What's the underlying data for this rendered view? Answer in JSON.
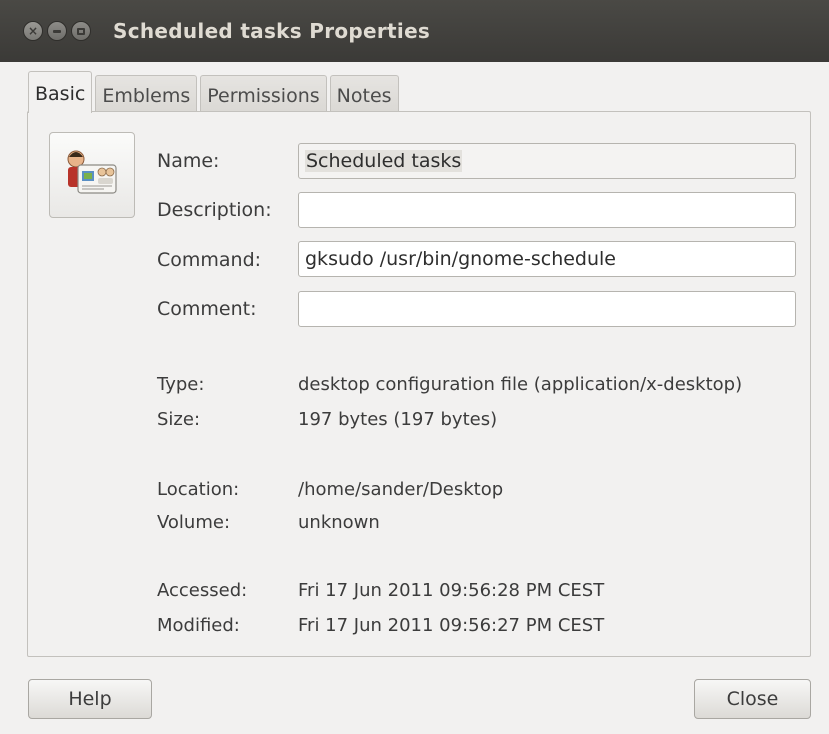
{
  "window": {
    "title": "Scheduled tasks Properties",
    "controls": [
      "close",
      "minimize",
      "maximize"
    ]
  },
  "tabs": [
    {
      "label": "Basic",
      "active": true
    },
    {
      "label": "Emblems",
      "active": false
    },
    {
      "label": "Permissions",
      "active": false
    },
    {
      "label": "Notes",
      "active": false
    }
  ],
  "icon": {
    "name": "schedule-app-icon"
  },
  "fields": {
    "name": {
      "label": "Name:",
      "value": "Scheduled tasks"
    },
    "description": {
      "label": "Description:",
      "value": ""
    },
    "command": {
      "label": "Command:",
      "value": "gksudo /usr/bin/gnome-schedule"
    },
    "comment": {
      "label": "Comment:",
      "value": ""
    }
  },
  "info": {
    "type": {
      "label": "Type:",
      "value": "desktop configuration file (application/x-desktop)"
    },
    "size": {
      "label": "Size:",
      "value": "197 bytes (197 bytes)"
    },
    "location": {
      "label": "Location:",
      "value": "/home/sander/Desktop"
    },
    "volume": {
      "label": "Volume:",
      "value": "unknown"
    },
    "accessed": {
      "label": "Accessed:",
      "value": "Fri 17 Jun 2011 09:56:28 PM CEST"
    },
    "modified": {
      "label": "Modified:",
      "value": "Fri 17 Jun 2011 09:56:27 PM CEST"
    }
  },
  "buttons": {
    "help": "Help",
    "close": "Close"
  }
}
